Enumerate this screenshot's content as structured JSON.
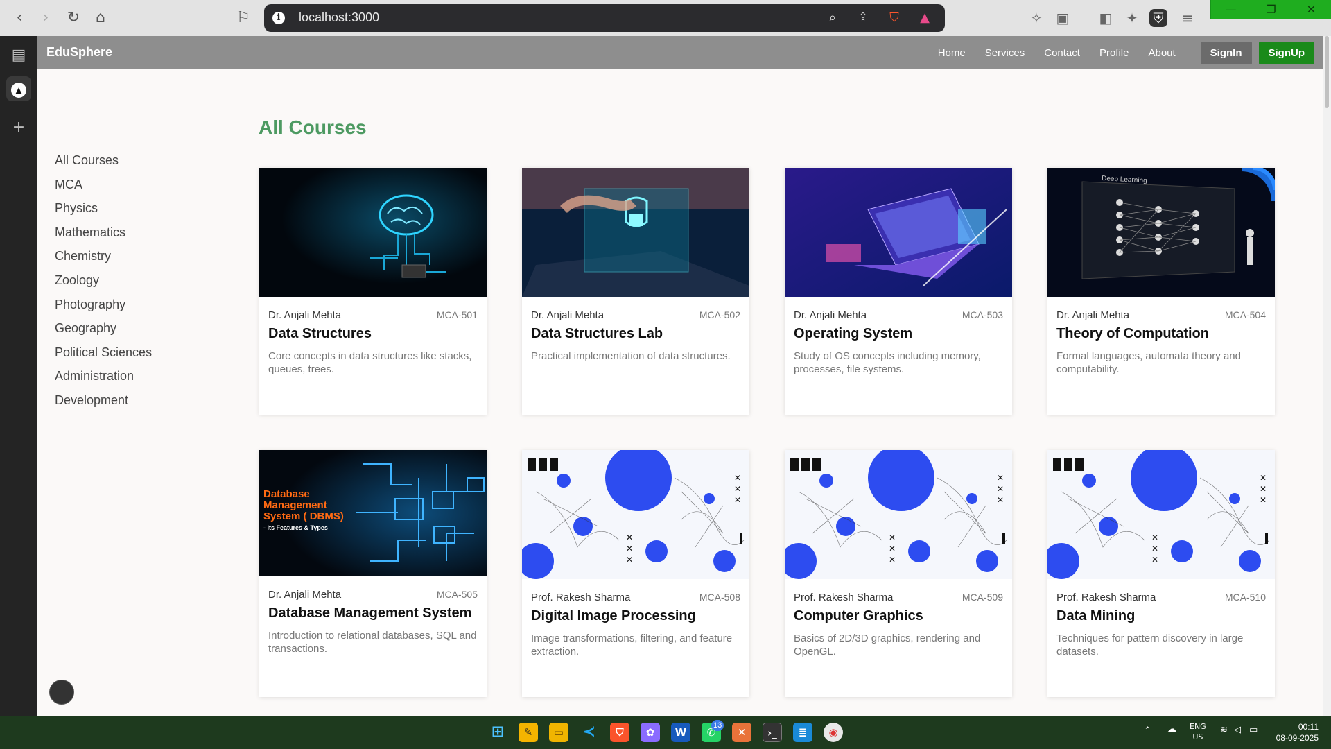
{
  "browser": {
    "url": "localhost:3000",
    "window_buttons": [
      "—",
      "❐",
      "✕"
    ]
  },
  "app": {
    "brand": "EduSphere",
    "nav": [
      "Home",
      "Services",
      "Contact",
      "Profile",
      "About"
    ],
    "signin": "SignIn",
    "signup": "SignUp"
  },
  "sidebar": {
    "categories": [
      "All Courses",
      "MCA",
      "Physics",
      "Mathematics",
      "Chemistry",
      "Zoology",
      "Photography",
      "Geography",
      "Political Sciences",
      "Administration",
      "Development"
    ]
  },
  "page": {
    "heading": "All Courses"
  },
  "courses": [
    {
      "instructor": "Dr. Anjali Mehta",
      "code": "MCA-501",
      "title": "Data Structures",
      "description": "Core concepts in data structures like stacks, queues, trees.",
      "image": "brain-circuit"
    },
    {
      "instructor": "Dr. Anjali Mehta",
      "code": "MCA-502",
      "title": "Data Structures Lab",
      "description": "Practical implementation of data structures.",
      "image": "laptop-lock"
    },
    {
      "instructor": "Dr. Anjali Mehta",
      "code": "MCA-503",
      "title": "Operating System",
      "description": "Study of OS concepts including memory, processes, file systems.",
      "image": "isometric-laptop"
    },
    {
      "instructor": "Dr. Anjali Mehta",
      "code": "MCA-504",
      "title": "Theory of Computation",
      "description": "Formal languages, automata theory and computability.",
      "image": "deep-learning",
      "image_text": "Deep Learning"
    },
    {
      "instructor": "Dr. Anjali Mehta",
      "code": "MCA-505",
      "title": "Database Management System",
      "description": "Introduction to relational databases, SQL and transactions.",
      "image": "dbms-circuit",
      "image_text": [
        "Database",
        "Management",
        "System ( DBMS)",
        "- Its Features & Types"
      ]
    },
    {
      "instructor": "Prof. Rakesh Sharma",
      "code": "MCA-508",
      "title": "Digital Image Processing",
      "description": "Image transformations, filtering, and feature extraction.",
      "image": "blue-pattern"
    },
    {
      "instructor": "Prof. Rakesh Sharma",
      "code": "MCA-509",
      "title": "Computer Graphics",
      "description": "Basics of 2D/3D graphics, rendering and OpenGL.",
      "image": "blue-pattern"
    },
    {
      "instructor": "Prof. Rakesh Sharma",
      "code": "MCA-510",
      "title": "Data Mining",
      "description": "Techniques for pattern discovery in large datasets.",
      "image": "blue-pattern"
    }
  ],
  "taskbar": {
    "language": [
      "ENG",
      "US"
    ],
    "time": "00:11",
    "date": "08-09-2025",
    "whatsapp_badge": "13"
  }
}
